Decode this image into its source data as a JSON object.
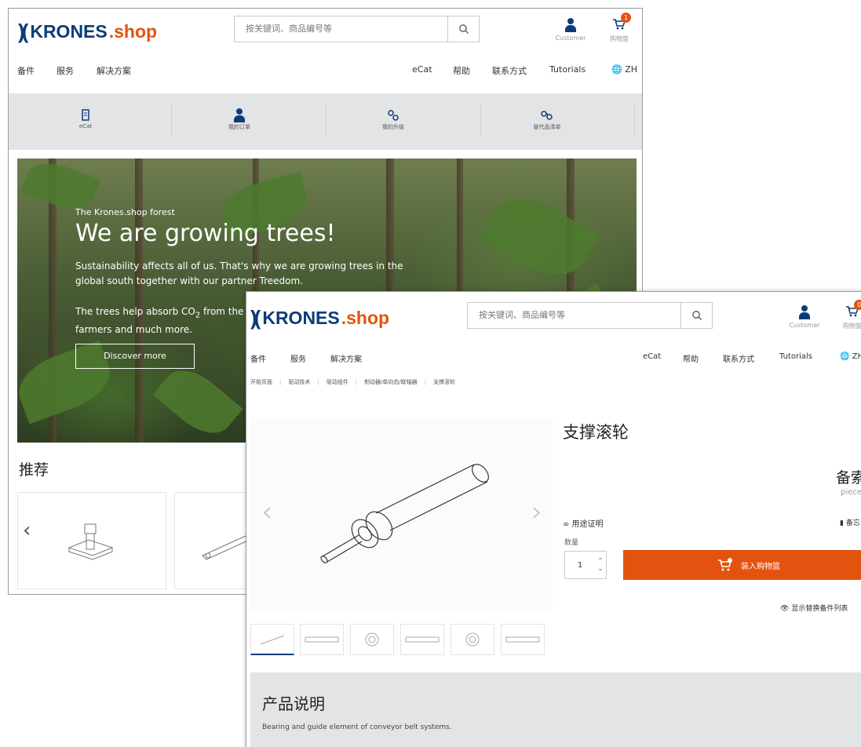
{
  "brand": {
    "mark": ")(",
    "name": "KRONES",
    "tld": ".shop"
  },
  "header": {
    "search_placeholder": "按关键词、商品编号等",
    "customer_label": "Customer",
    "cart_label": "购物篮",
    "cart_count_w1": "1",
    "cart_count_w2": "0"
  },
  "nav": {
    "left": [
      "备件",
      "服务",
      "解决方案"
    ],
    "right": [
      "eCat",
      "帮助",
      "联系方式",
      "Tutorials"
    ],
    "lang": "ZH"
  },
  "quicklinks": [
    {
      "label": "eCat",
      "icon": "catalog-icon"
    },
    {
      "label": "我的订单",
      "icon": "person-icon"
    },
    {
      "label": "我的升级",
      "icon": "gears-icon"
    },
    {
      "label": "替代品清单",
      "icon": "swap-icon"
    }
  ],
  "hero": {
    "kicker": "The Krones.shop forest",
    "title": "We are growing trees!",
    "paragraph1": "Sustainability affects all of us. That's why we are growing trees in the global south together with our partner Treedom.",
    "paragraph2_start": "The trees help absorb CO",
    "paragraph2_sub": "2",
    "paragraph2_end": " from the farmers and much more.",
    "cta": "Discover more"
  },
  "recommendations": {
    "title": "推荐"
  },
  "product": {
    "breadcrumb": [
      "开始页面",
      "驱动技术",
      "驱动组件",
      "制动器/单向齿/联轴器",
      "支撑滚轮"
    ],
    "title": "支撑滚轮",
    "spare_label": "备索",
    "unit": "piece",
    "proof_label": "用途证明",
    "memo_label": "备忘",
    "qty_label": "数量",
    "qty_value": "1",
    "add_to_cart": "装入购物篮",
    "show_alternatives": "显示替换备件列表",
    "description_title": "产品说明",
    "description": "Bearing and guide element of conveyor belt systems."
  },
  "colors": {
    "brand_blue": "#0c3c78",
    "accent_orange": "#e3530f",
    "panel_gray": "#e3e4e6"
  }
}
